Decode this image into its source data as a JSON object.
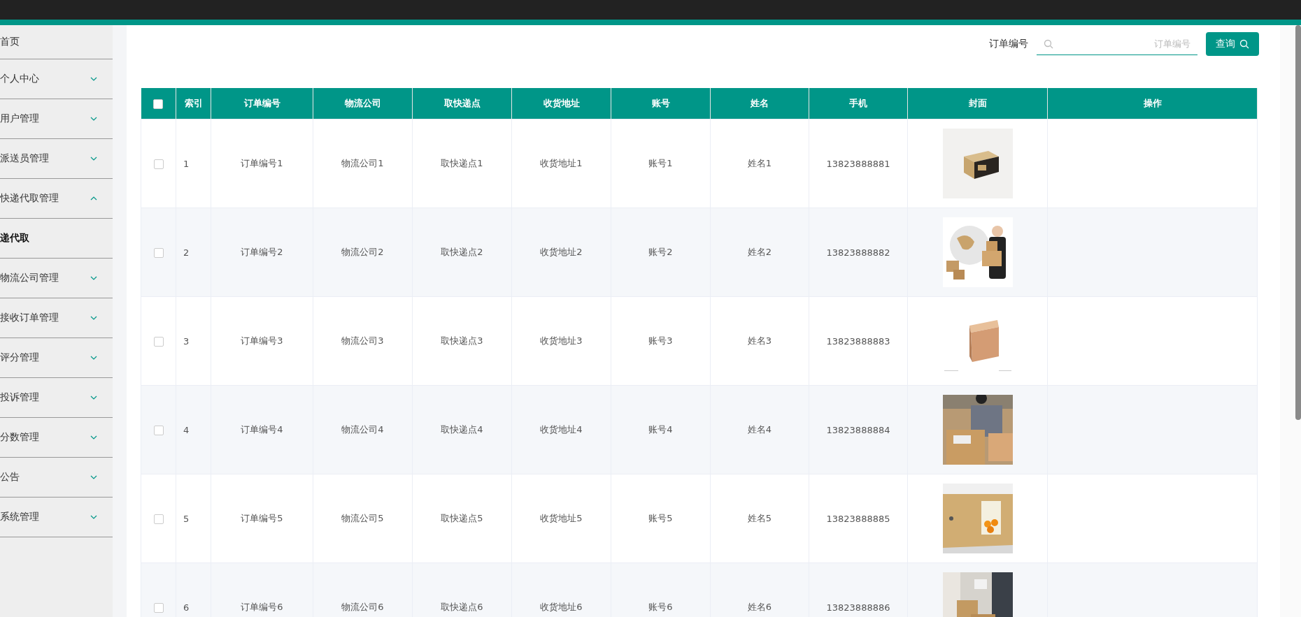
{
  "sidebar": {
    "items": [
      {
        "label": "首页"
      },
      {
        "label": "个人中心",
        "expanded": false
      },
      {
        "label": "用户管理",
        "expanded": false
      },
      {
        "label": "派送员管理",
        "expanded": false
      },
      {
        "label": "快递代取管理",
        "expanded": true,
        "children": [
          {
            "label": "递代取"
          }
        ]
      },
      {
        "label": "物流公司管理",
        "expanded": false
      },
      {
        "label": "接收订单管理",
        "expanded": false
      },
      {
        "label": "评分管理",
        "expanded": false
      },
      {
        "label": "投诉管理",
        "expanded": false
      },
      {
        "label": "分数管理",
        "expanded": false
      },
      {
        "label": "公告",
        "expanded": false
      },
      {
        "label": "系统管理",
        "expanded": false
      }
    ]
  },
  "search": {
    "label": "订单编号",
    "placeholder": "订单编号",
    "button": "查询"
  },
  "table": {
    "select_all": {
      "checked": false
    },
    "columns": [
      "索引",
      "订单编号",
      "物流公司",
      "取快递点",
      "收货地址",
      "账号",
      "姓名",
      "手机",
      "封面",
      "操作"
    ],
    "rows": [
      {
        "checked": false,
        "cells": [
          "1",
          "订单编号1",
          "物流公司1",
          "取快递点1",
          "收货地址1",
          "账号1",
          "姓名1",
          "13823888881"
        ]
      },
      {
        "checked": false,
        "cells": [
          "2",
          "订单编号2",
          "物流公司2",
          "取快递点2",
          "收货地址2",
          "账号2",
          "姓名2",
          "13823888882"
        ]
      },
      {
        "checked": false,
        "cells": [
          "3",
          "订单编号3",
          "物流公司3",
          "取快递点3",
          "收货地址3",
          "账号3",
          "姓名3",
          "13823888883"
        ]
      },
      {
        "checked": false,
        "cells": [
          "4",
          "订单编号4",
          "物流公司4",
          "取快递点4",
          "收货地址4",
          "账号4",
          "姓名4",
          "13823888884"
        ]
      },
      {
        "checked": false,
        "cells": [
          "5",
          "订单编号5",
          "物流公司5",
          "取快递点5",
          "收货地址5",
          "账号5",
          "姓名5",
          "13823888885"
        ]
      },
      {
        "checked": false,
        "cells": [
          "6",
          "订单编号6",
          "物流公司6",
          "取快递点6",
          "收货地址6",
          "账号6",
          "姓名6",
          "13823888886"
        ]
      }
    ]
  }
}
